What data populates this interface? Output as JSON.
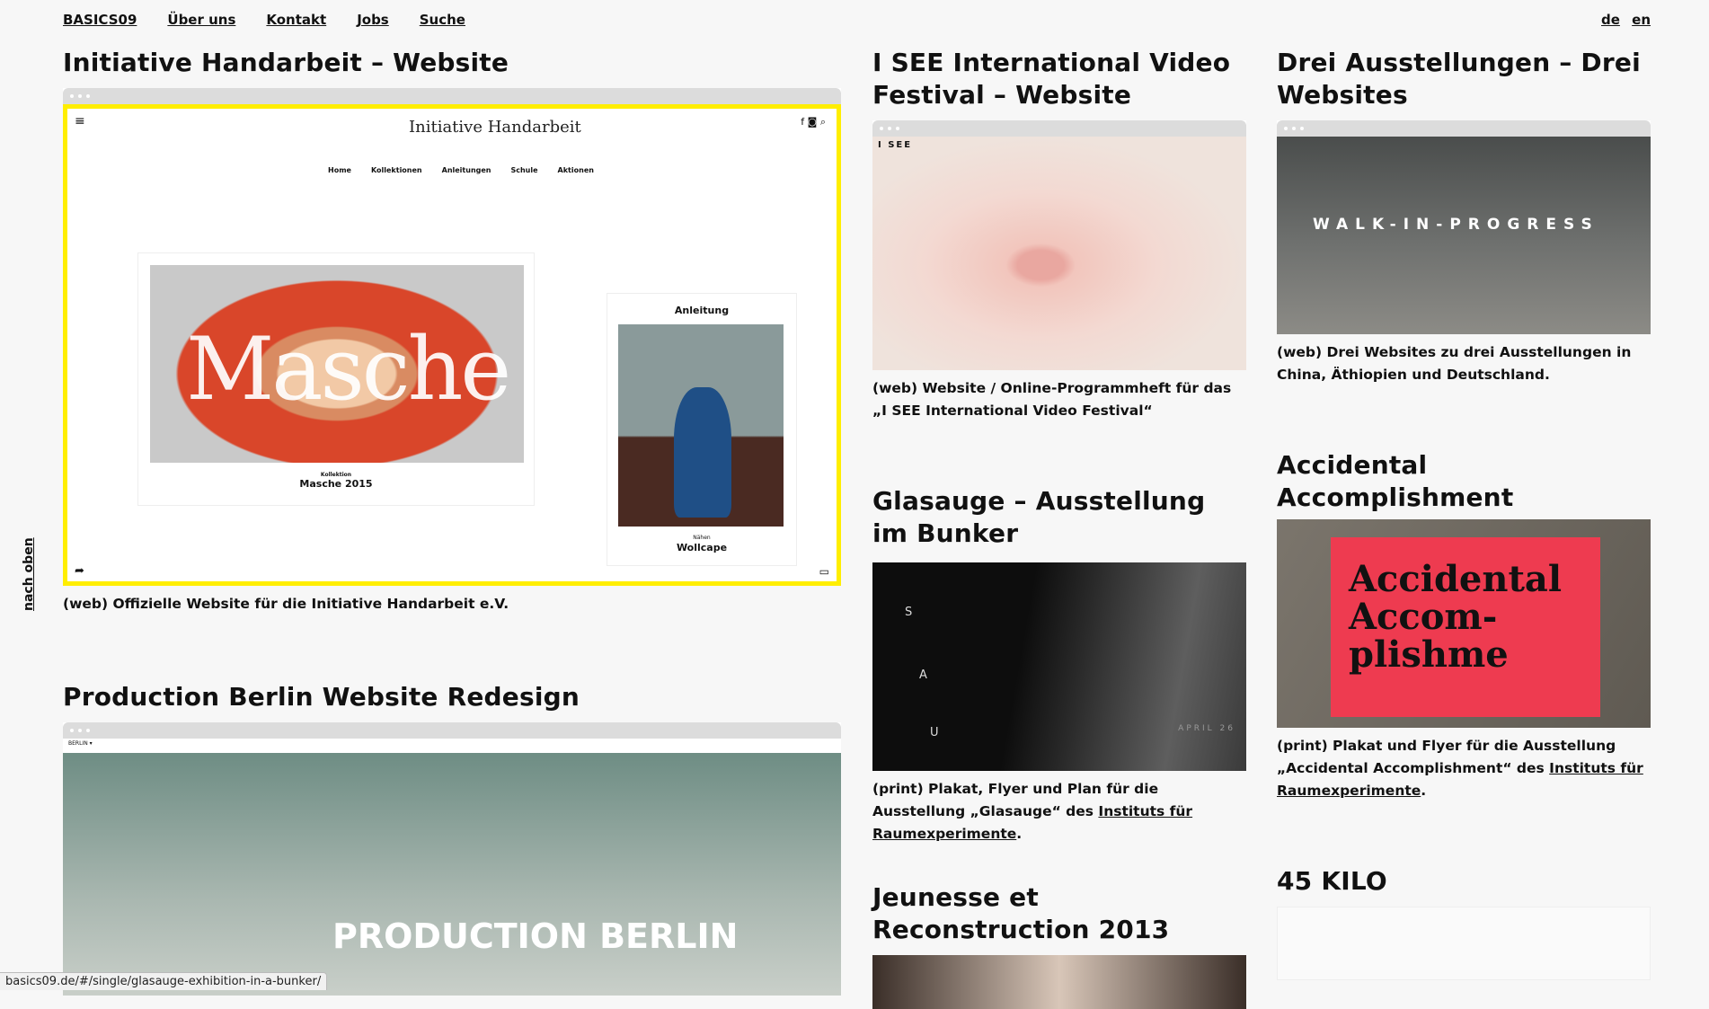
{
  "nav": {
    "items": [
      "BASICS09",
      "Über uns",
      "Kontakt",
      "Jobs",
      "Suche"
    ],
    "lang": [
      "de",
      "en"
    ],
    "back_to_top": "nach oben"
  },
  "projects": {
    "handarbeit": {
      "title": "Initiative Handarbeit – Website",
      "desc": "(web) Offizielle Website für die Initiative Handarbeit e.V.",
      "logo": "Initiative Handarbeit",
      "menu": [
        "Home",
        "Kollektionen",
        "Anleitungen",
        "Schule",
        "Aktionen"
      ],
      "hero_word": "Masche",
      "hero_kicker": "Kollektion",
      "hero_caption": "Masche 2015",
      "side_title": "Anleitung",
      "side_kicker": "Nähen",
      "side_caption": "Wollcape"
    },
    "production": {
      "title": "Production Berlin Website Redesign",
      "logo": "BERLIN ▾",
      "hero_word": "PRODUCTION BERLIN"
    },
    "isee": {
      "title": "I SEE International Video Festival – Website",
      "logo": "I SEE",
      "desc": "(web) Website / Online-Programmheft für das „I SEE International Video Festival“"
    },
    "glasauge": {
      "title": "Glasauge – Ausstellung im Bunker",
      "desc_prefix": "(print) Plakat, Flyer und Plan für die Ausstellung „Glasauge“ des ",
      "desc_link": "Instituts für Raumexperimente",
      "desc_suffix": ".",
      "poster_letters": [
        "S",
        "A",
        "U"
      ],
      "poster_date": "APRIL 26"
    },
    "jeunesse": {
      "title": "Jeunesse et Reconstruction 2013"
    },
    "drei": {
      "title": "Drei Ausstellungen – Drei Websites",
      "shot_text": "WALK-IN-PROGRESS",
      "desc": "(web) Drei Websites zu drei Ausstellungen in China, Äthiopien und Deutschland."
    },
    "accidental": {
      "title": "Accidental Accomplishment",
      "poster_text": "Accidental Accom- plishme",
      "desc_prefix": "(print) Plakat und Flyer für die Ausstellung „Accidental Accomplishment“ des ",
      "desc_link": "Instituts für Raumexperimente",
      "desc_suffix": "."
    },
    "kilo": {
      "title": "45 KILO"
    }
  },
  "status_url": "basics09.de/#/single/glasauge-exhibition-in-a-bunker/"
}
